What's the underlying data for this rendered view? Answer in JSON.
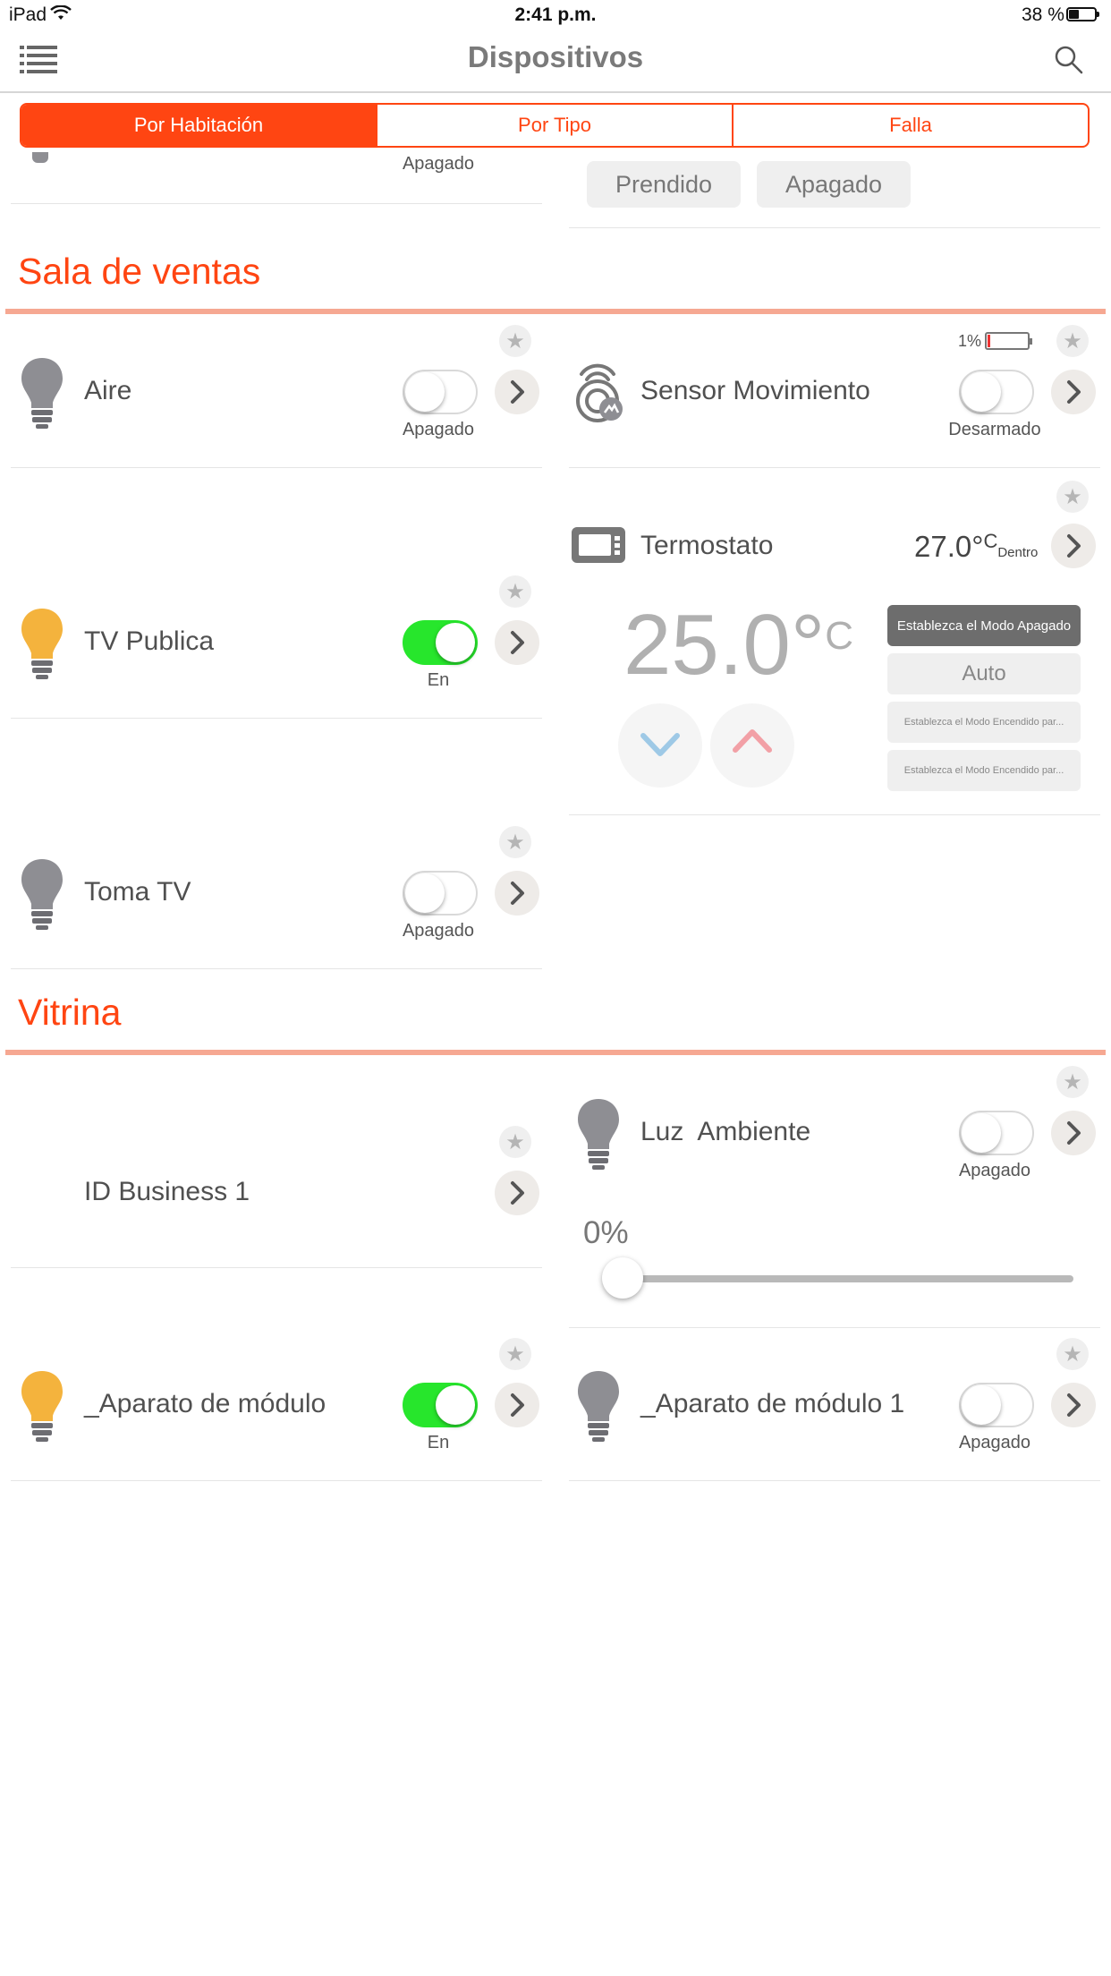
{
  "status_bar": {
    "carrier": "iPad",
    "time": "2:41 p.m.",
    "battery": "38 %"
  },
  "nav": {
    "title": "Dispositivos",
    "menu_icon": "list-icon",
    "search_icon": "search-icon"
  },
  "tabs": [
    {
      "label": "Por Habitación",
      "active": true
    },
    {
      "label": "Por Tipo",
      "active": false
    },
    {
      "label": "Falla",
      "active": false
    }
  ],
  "colors": {
    "accent": "#ff4512",
    "section_line": "#f6a892",
    "toggle_on": "#27e62c",
    "bulb_on": "#f4b33d",
    "bulb_off": "#8e8e93"
  },
  "top_partial": {
    "left_state": "Apagado",
    "btn_on": "Prendido",
    "btn_off": "Apagado"
  },
  "sections": [
    {
      "title": "Sala de ventas",
      "devices": {
        "aire": {
          "name": "Aire",
          "state": "Apagado",
          "on": false
        },
        "sensor": {
          "name": "Sensor Movimiento",
          "state": "Desarmado",
          "battery": "1%",
          "on": false
        },
        "tv_publica": {
          "name": "TV Publica",
          "state": "En",
          "on": true
        },
        "termostato": {
          "name": "Termostato",
          "inside_temp": "27.0°",
          "inside_unit": "C",
          "inside_label": "Dentro",
          "setpoint": "25.0°",
          "setpoint_unit": "C",
          "modes": [
            "Establezca el Modo Apagado",
            "Auto",
            "Establezca el Modo Encendido par...",
            "Establezca el Modo Encendido par..."
          ]
        },
        "toma_tv": {
          "name": "Toma TV",
          "state": "Apagado",
          "on": false
        }
      }
    },
    {
      "title": "Vitrina",
      "devices": {
        "id_business": {
          "name": "ID Business 1"
        },
        "luz_ambiente": {
          "name": "Luz  Ambiente",
          "state": "Apagado",
          "on": false,
          "dimmer": "0%",
          "dimmer_value": 0
        },
        "aparato": {
          "name": "_Aparato de módulo",
          "state": "En",
          "on": true
        },
        "aparato1": {
          "name": "_Aparato de módulo 1",
          "state": "Apagado",
          "on": false
        }
      }
    }
  ]
}
